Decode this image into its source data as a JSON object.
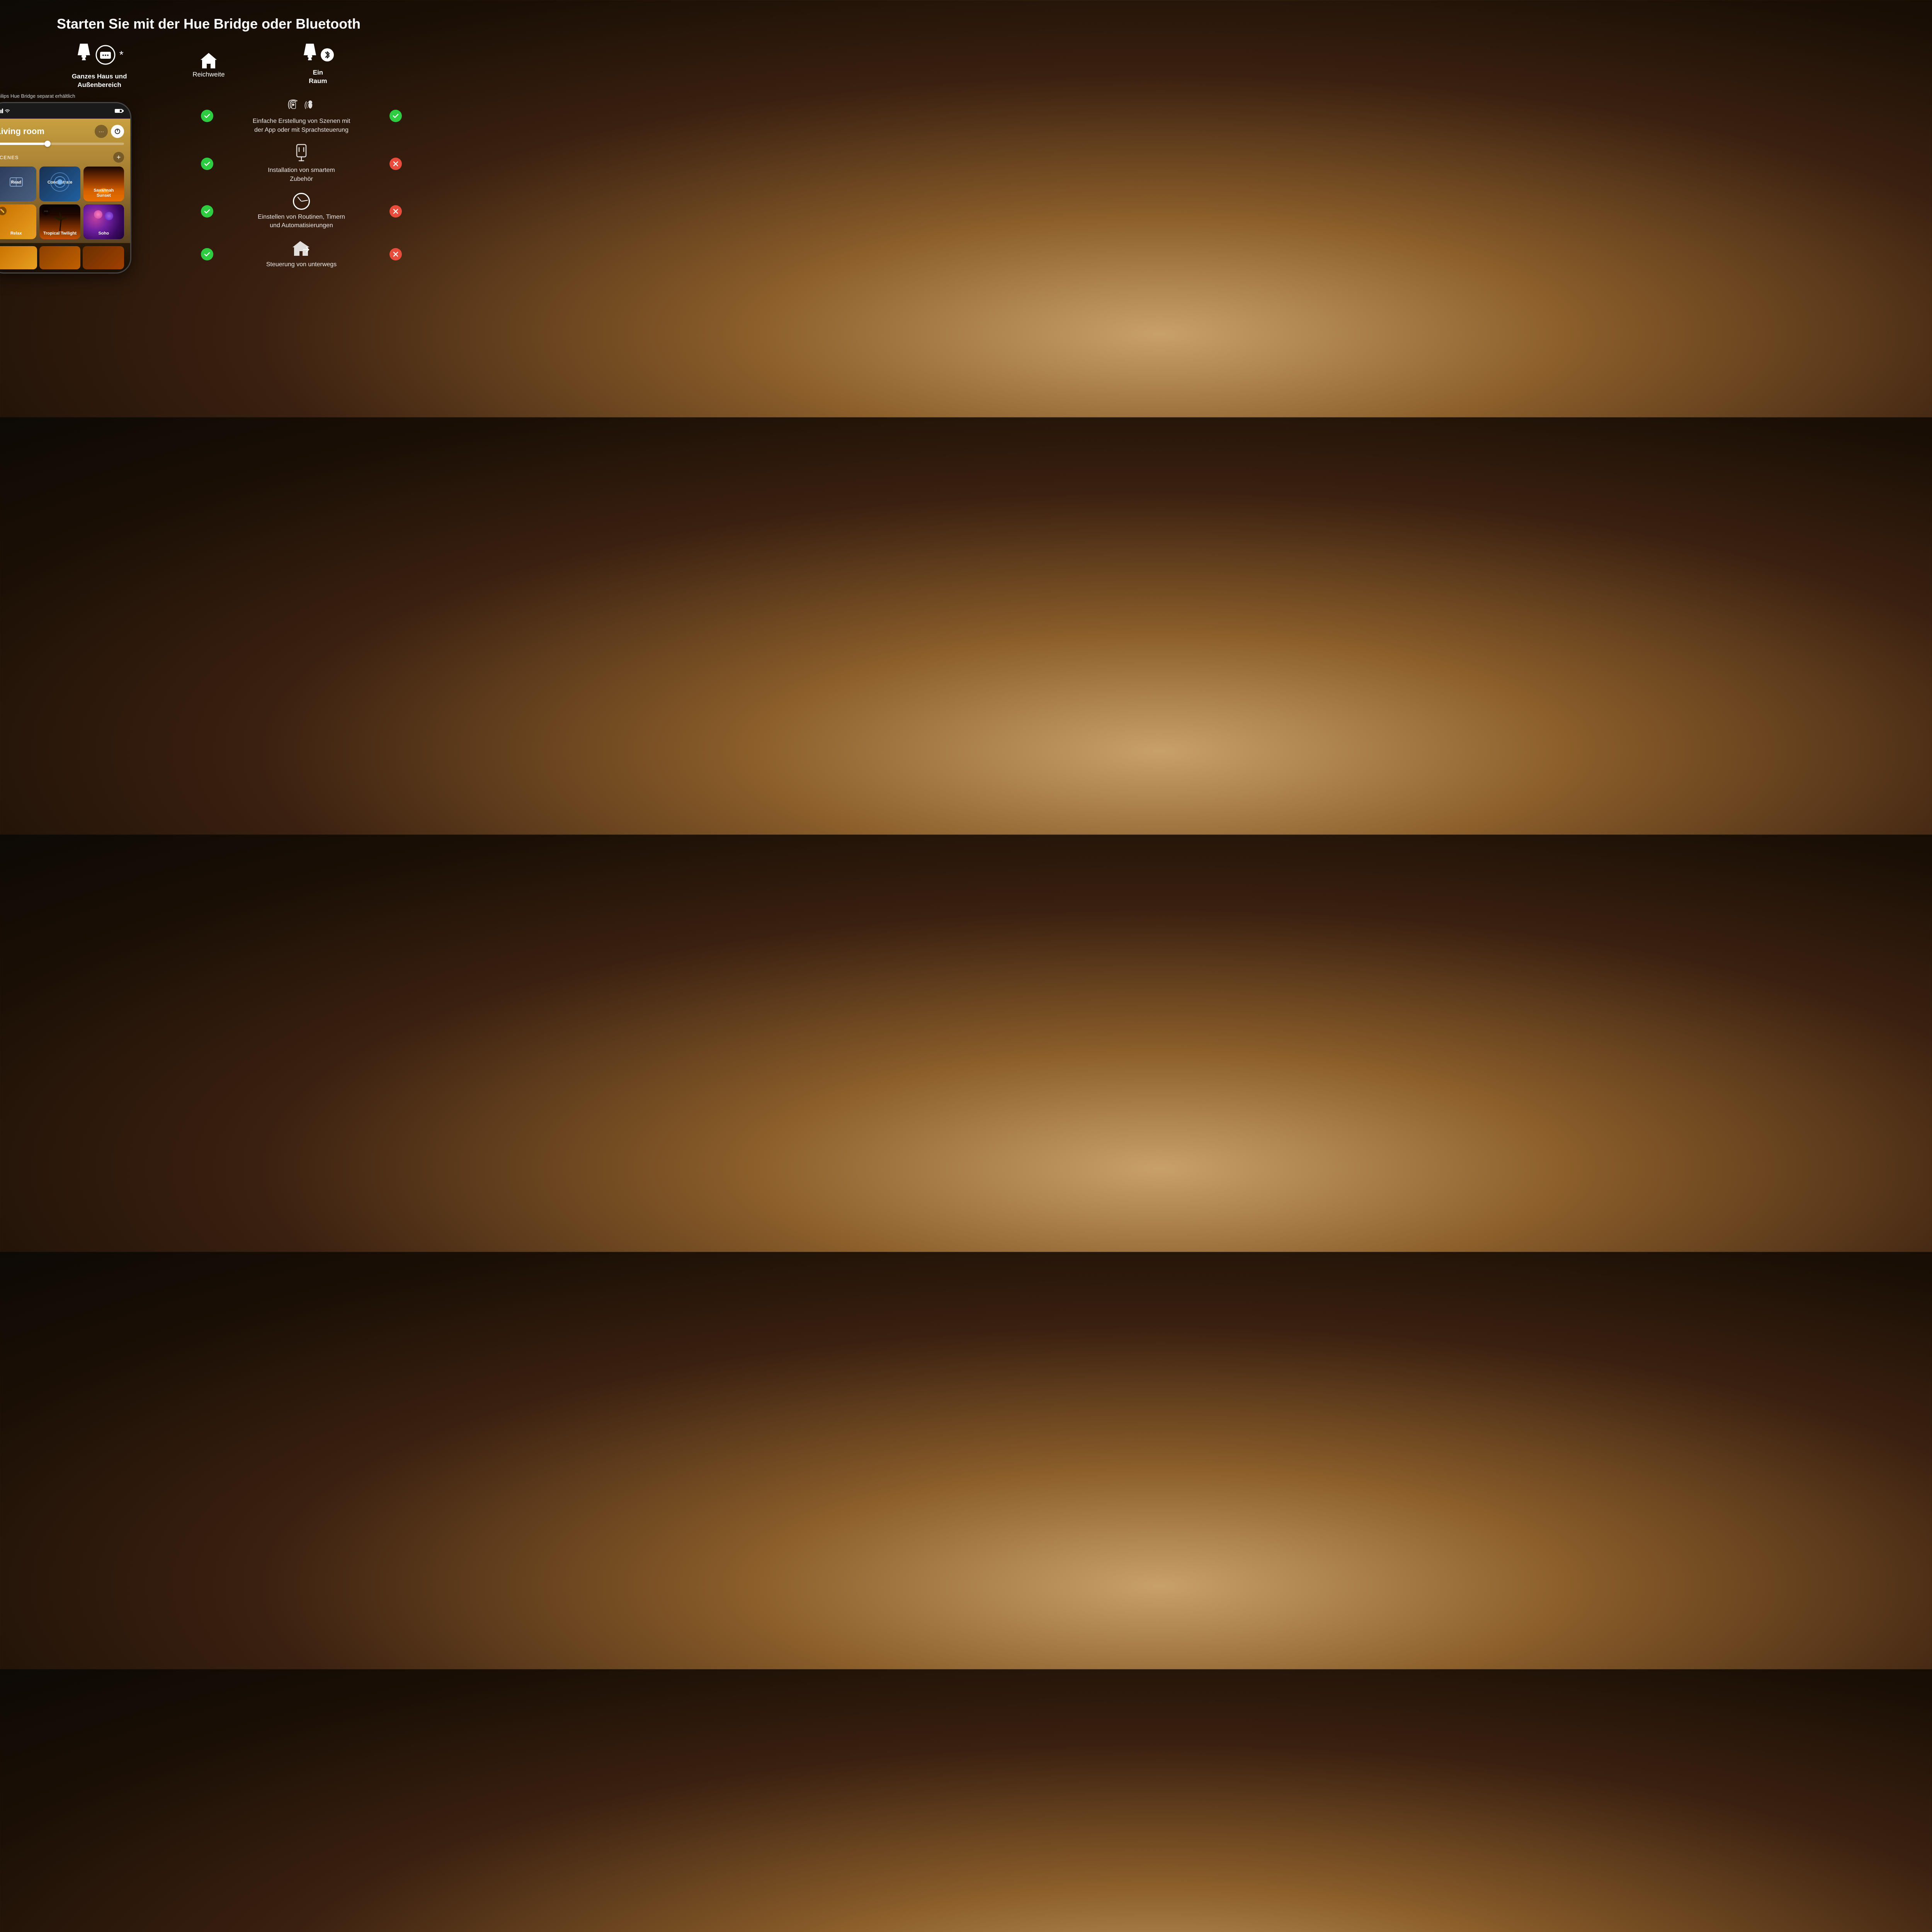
{
  "page": {
    "title": "Starten Sie mit der Hue Bridge oder Bluetooth",
    "bridge_note": "*Philips Hue Bridge separat erhältlich",
    "asterisk": "*"
  },
  "columns": {
    "bridge": {
      "label_line1": "Ganzes Haus und",
      "label_line2": "Außenbereich"
    },
    "reach": {
      "label": "Reichweite"
    },
    "bluetooth": {
      "label_line1": "Ein",
      "label_line2": "Raum"
    }
  },
  "phone": {
    "room": "Living room",
    "scenes_label": "SCENES",
    "scenes": [
      {
        "name": "Read",
        "type": "read"
      },
      {
        "name": "Concentrate",
        "type": "concentrate"
      },
      {
        "name": "Savannah Sunset",
        "type": "savannah"
      },
      {
        "name": "Relax",
        "type": "relax",
        "has_edit": true
      },
      {
        "name": "Tropical Twilight",
        "type": "tropical",
        "has_more": true
      },
      {
        "name": "Soho",
        "type": "soho"
      }
    ],
    "bottom_scenes": [
      {
        "type": "warm1"
      },
      {
        "type": "warm2"
      },
      {
        "type": "warm3"
      }
    ]
  },
  "features": [
    {
      "id": "scene-creation",
      "icon_type": "nfc-voice",
      "description": "Einfache Erstellung von Szenen mit der App oder mit Sprachsteuerung",
      "bridge_check": true,
      "bluetooth_check": true
    },
    {
      "id": "smart-accessories",
      "icon_type": "plug",
      "description": "Installation von smartem Zubehör",
      "bridge_check": true,
      "bluetooth_check": false
    },
    {
      "id": "routines",
      "icon_type": "clock",
      "description": "Einstellen von Routinen, Timern und Automatisierungen",
      "bridge_check": true,
      "bluetooth_check": false
    },
    {
      "id": "remote-control",
      "icon_type": "remote",
      "description": "Steuerung von unterwegs",
      "bridge_check": true,
      "bluetooth_check": false
    }
  ],
  "colors": {
    "check_green": "#2ecc40",
    "cross_red": "#e74c3c",
    "bg_dark": "#1a0f05",
    "bg_mid": "#8b5e2a",
    "bg_light": "#c8a06a"
  }
}
